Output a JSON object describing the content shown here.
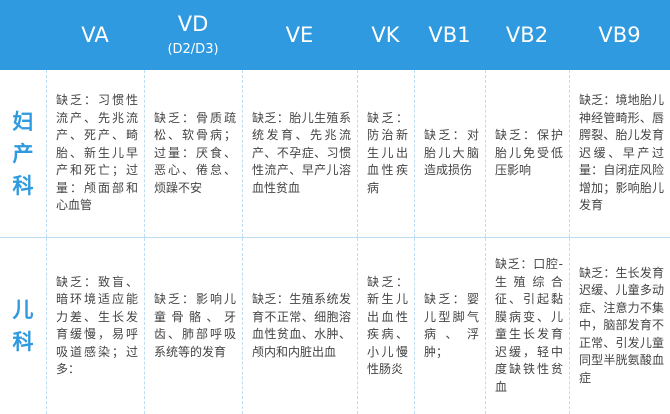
{
  "header": {
    "columns": [
      {
        "name": "VA",
        "sub": ""
      },
      {
        "name": "VD",
        "sub": "(D2/D3)"
      },
      {
        "name": "VE",
        "sub": ""
      },
      {
        "name": "VK",
        "sub": ""
      },
      {
        "name": "VB1",
        "sub": ""
      },
      {
        "name": "VB2",
        "sub": ""
      },
      {
        "name": "VB9",
        "sub": ""
      }
    ]
  },
  "rows": [
    {
      "label": "妇产科",
      "cells": [
        "缺乏：习惯性流产、先兆流产、死产、畸胎、新生儿早产和死亡；过量：颅面部和心血管",
        "缺乏：骨质疏松、软骨病；过量：厌食、恶心、倦怠、烦躁不安",
        "缺乏：胎儿生殖系统发育、先兆流产、不孕症、习惯性流产、早产儿溶血性贫血",
        "缺乏：防治新生儿出血性疾病",
        "缺乏：对胎儿大脑造成损伤",
        "缺乏：保护胎儿免受低压影响",
        "缺乏：境地胎儿神经管畸形、唇腭裂、胎儿发育迟缓、早产过量：自闭症风险增加；影响胎儿发育"
      ]
    },
    {
      "label": "儿科",
      "cells": [
        "缺乏：致盲、暗环境适应能力差、生长发育缓慢，易呼吸道感染；过多：",
        "缺乏：影响儿童骨骼、牙齿、肺部呼吸系统等的发育",
        "缺乏：生殖系统发育不正常、细胞溶血性贫血、水肿、颅内和内脏出血",
        "缺乏：新生儿出血性疾病、小儿慢性肠炎",
        "缺乏：婴儿型脚气病、浮肿；",
        "缺乏：口腔-生殖综合征、引起黏膜病变、儿童生长发育迟缓，轻中度缺铁性贫血",
        "缺乏：生长发育迟缓、儿童多动症、注意力不集中，脑部发育不正常、引发儿童同型半胱氨酸血症"
      ]
    }
  ]
}
